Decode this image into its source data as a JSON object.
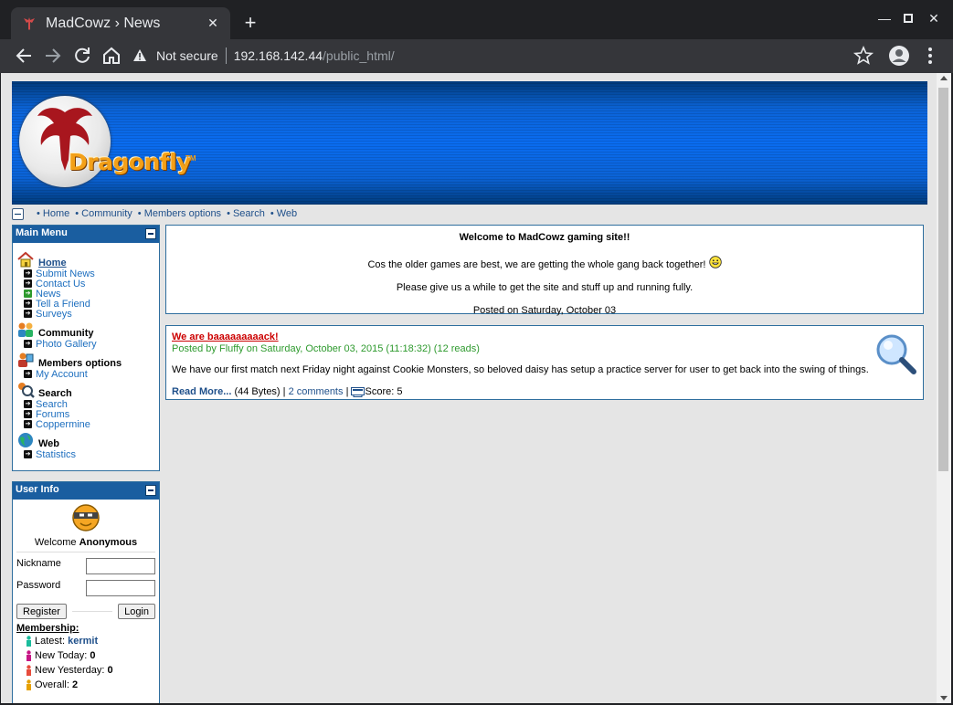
{
  "browser": {
    "tab_title": "MadCowz › News",
    "security_label": "Not secure",
    "url_host": "192.168.142.44",
    "url_path": "/public_html/"
  },
  "banner": {
    "logo_text": "Dragonfly",
    "logo_tm": "TM"
  },
  "topnav": [
    "• Home",
    "• Community",
    "• Members options",
    "• Search",
    "• Web"
  ],
  "main_menu": {
    "title": "Main Menu",
    "home": "Home",
    "home_items": [
      "Submit News",
      "Contact Us",
      "News",
      "Tell a Friend",
      "Surveys"
    ],
    "community": "Community",
    "community_items": [
      "Photo Gallery"
    ],
    "members": "Members options",
    "members_items": [
      "My Account"
    ],
    "search": "Search",
    "search_items": [
      "Search",
      "Forums",
      "Coppermine"
    ],
    "web": "Web",
    "web_items": [
      "Statistics"
    ]
  },
  "user_info": {
    "title": "User Info",
    "welcome_prefix": "Welcome",
    "welcome_user": "Anonymous",
    "nickname_label": "Nickname",
    "password_label": "Password",
    "register_label": "Register",
    "login_label": "Login",
    "membership_label": "Membership:",
    "latest_label": "Latest:",
    "latest_value": "kermit",
    "today_label": "New Today:",
    "today_value": "0",
    "yesterday_label": "New Yesterday:",
    "yesterday_value": "0",
    "overall_label": "Overall:",
    "overall_value": "2"
  },
  "welcome_box": {
    "title": "Welcome to MadCowz gaming site!!",
    "line1": "Cos the older games are best, we are getting the whole gang back together!",
    "line2": "Please give us a while to get the site and stuff up and running fully.",
    "posted": "Posted on Saturday, October 03"
  },
  "news_item": {
    "title": "We are baaaaaaaaack!",
    "posted_by_prefix": "Posted by",
    "author": "Fluffy",
    "posted_on": "on Saturday, October 03, 2015 (11:18:32) (12 reads)",
    "body": "We have our first match next Friday night against Cookie Monsters, so beloved daisy has setup a practice server for user to get back into the swing of things.",
    "read_more": "Read More...",
    "size": "(44 Bytes) |",
    "comments": "2 comments",
    "sep": "|",
    "score": "Score: 5"
  },
  "colors": {
    "header_blue": "#1a5ea0",
    "link_blue": "#1e4f8a",
    "news_title_red": "#cc0000",
    "posted_green": "#2e9a2e"
  }
}
